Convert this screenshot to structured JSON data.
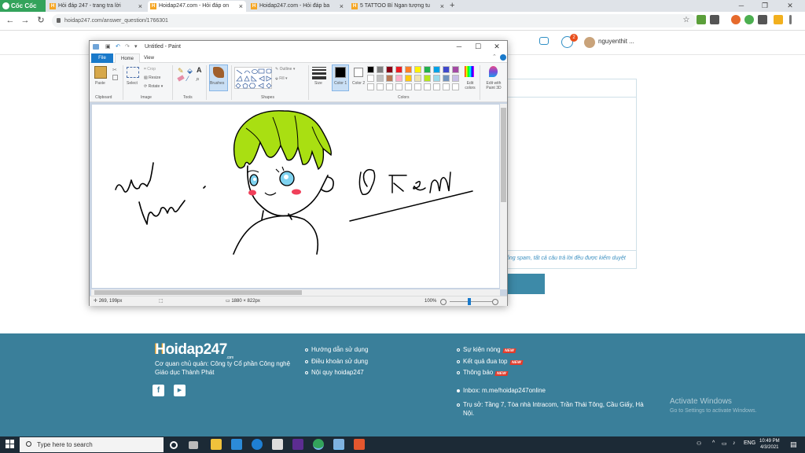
{
  "browser": {
    "brand": "Cốc Cốc",
    "tabs": [
      {
        "title": "Hỏi đáp 247 - trang tra lời"
      },
      {
        "title": "Hoidap247.com - Hỏi đáp on"
      },
      {
        "title": "Hoidap247.com - Hỏi đáp ba"
      },
      {
        "title": "5 TATTOO Bí Ngan tượng tu"
      }
    ],
    "url": "hoidap247.com/answer_question/1766301",
    "new_tab": "+"
  },
  "site": {
    "username": "nguyenthit ...",
    "notif_count": "2",
    "policy_text": "ống spam, tất cả câu trả lời đều được kiểm duyệt"
  },
  "paint": {
    "title": "Untitled - Paint",
    "menu": {
      "file": "File",
      "home": "Home",
      "view": "View"
    },
    "ribbon": {
      "paste": "Paste",
      "clipboard": "Clipboard",
      "crop": "Crop",
      "resize": "Resize",
      "rotate": "Rotate",
      "select": "Select",
      "image": "Image",
      "tools": "Tools",
      "brushes": "Brushes",
      "shapes": "Shapes",
      "outline": "Outline",
      "fill": "Fill",
      "size": "Size",
      "color1": "Color 1",
      "color2": "Color 2",
      "colors": "Colors",
      "edit_colors": "Edit colors",
      "edit_paint3d": "Edit with Paint 3D"
    },
    "palette": [
      "#000000",
      "#7f7f7f",
      "#880015",
      "#ed1c24",
      "#ff7f27",
      "#fff200",
      "#22b14c",
      "#00a2e8",
      "#3f48cc",
      "#a349a4",
      "#ffffff",
      "#c3c3c3",
      "#b97a57",
      "#ffaec9",
      "#ffc90e",
      "#efe4b0",
      "#b5e61d",
      "#99d9ea",
      "#7092be",
      "#c8bfe7"
    ],
    "status": {
      "cursor": "269, 199px",
      "size": "1880 × 822px",
      "zoom": "100%"
    }
  },
  "footer": {
    "logo": "Hoidap247",
    "logo_suffix": ".com",
    "owner": "Cơ quan chủ quản: Công ty Cổ phần Công nghệ",
    "owner2": "Giáo dục Thành Phát",
    "links1": [
      "Hướng dẫn sử dụng",
      "Điều khoản sử dụng",
      "Nội quy hoidap247"
    ],
    "links2": [
      "Sự kiện nóng",
      "Kết quả đua top",
      "Thông báo"
    ],
    "new_badge": "NEW",
    "inbox": "Inbox: m.me/hoidap247online",
    "address": "Trụ sở: Tầng 7, Tòa nhà Intracom, Trần Thái Tông, Cầu Giấy, Hà",
    "address2": "Nội.",
    "social": [
      "f",
      "▶"
    ],
    "activate_title": "Activate Windows",
    "activate_sub": "Go to Settings to activate Windows."
  },
  "taskbar": {
    "search_placeholder": "Type here to search",
    "lang": "ENG",
    "time": "10:49 PM",
    "date": "4/3/2021"
  },
  "drawing": {
    "signature": "@kem"
  }
}
